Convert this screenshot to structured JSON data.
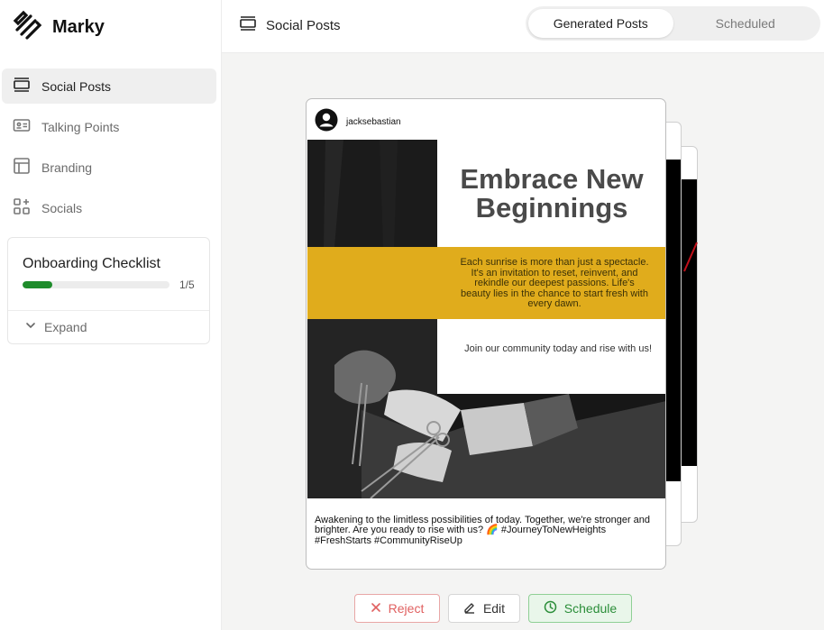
{
  "app": {
    "name": "Marky"
  },
  "sidebar": {
    "items": [
      {
        "label": "Social Posts",
        "icon": "social-posts-icon",
        "active": true
      },
      {
        "label": "Talking Points",
        "icon": "talking-points-icon",
        "active": false
      },
      {
        "label": "Branding",
        "icon": "branding-layout-icon",
        "active": false
      },
      {
        "label": "Socials",
        "icon": "socials-grid-plus-icon",
        "active": false
      }
    ],
    "checklist": {
      "title": "Onboarding Checklist",
      "completed": 1,
      "total": 5,
      "count_label": "1/5",
      "progress": 0.2,
      "expand_label": "Expand"
    }
  },
  "header": {
    "title": "Social Posts",
    "tabs": [
      {
        "label": "Generated Posts",
        "active": true
      },
      {
        "label": "Scheduled",
        "active": false
      }
    ]
  },
  "post": {
    "username": "jacksebastian",
    "headline": "Embrace New Beginnings",
    "band_text": "Each sunrise is more than just a spectacle. It's an invitation to reset, reinvent, and rekindle our deepest passions. Life's beauty lies in the chance to start fresh with every dawn.",
    "cta_text": "Join our community today and rise with us!",
    "caption": "Awakening to the limitless possibilities of today. Together, we're stronger and brighter. Are you ready to rise with us? 🌈 #JourneyToNewHeights #FreshStarts #CommunityRiseUp"
  },
  "actions": {
    "reject": "Reject",
    "edit": "Edit",
    "schedule": "Schedule"
  },
  "colors": {
    "accent_green": "#1e8c2b",
    "reject_red": "#e06060",
    "band_yellow": "#e0ac1c"
  }
}
